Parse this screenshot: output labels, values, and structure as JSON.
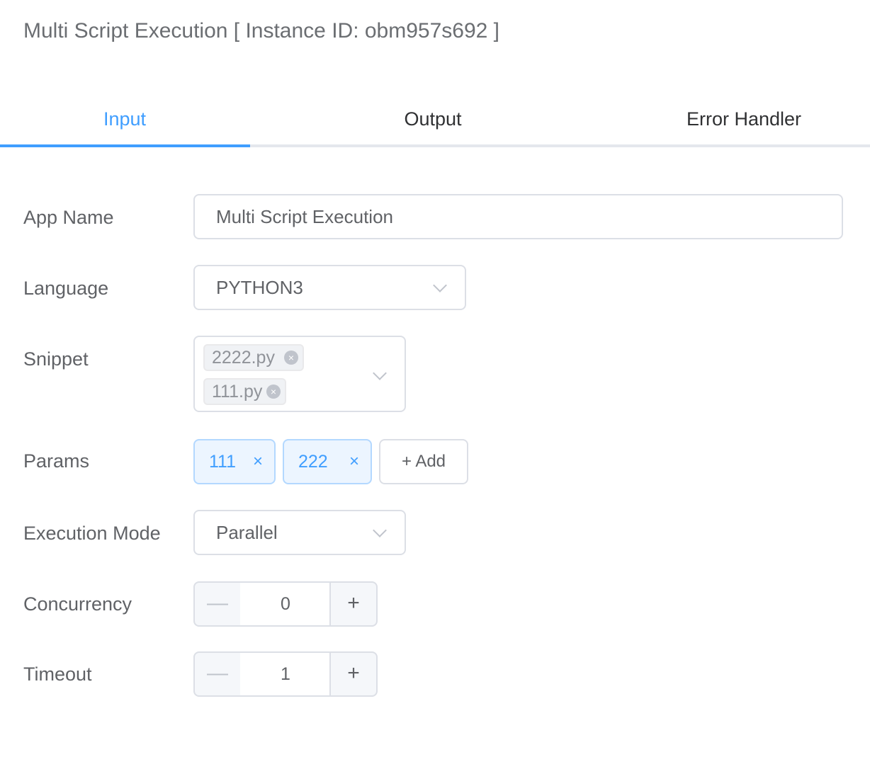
{
  "header": {
    "title": "Multi Script Execution [ Instance ID: obm957s692 ]"
  },
  "tabs": [
    {
      "label": "Input",
      "active": true
    },
    {
      "label": "Output",
      "active": false
    },
    {
      "label": "Error Handler",
      "active": false
    }
  ],
  "form": {
    "app_name": {
      "label": "App Name",
      "value": "Multi Script Execution"
    },
    "language": {
      "label": "Language",
      "value": "PYTHON3"
    },
    "snippet": {
      "label": "Snippet",
      "tags": [
        "2222.py",
        "111.py"
      ]
    },
    "params": {
      "label": "Params",
      "tags": [
        "111",
        "222"
      ],
      "add_label": "+ Add"
    },
    "execution_mode": {
      "label": "Execution Mode",
      "value": "Parallel"
    },
    "concurrency": {
      "label": "Concurrency",
      "value": "0"
    },
    "timeout": {
      "label": "Timeout",
      "value": "1"
    }
  },
  "glyphs": {
    "minus": "—",
    "plus": "+",
    "close": "×"
  },
  "colors": {
    "accent": "#409eff",
    "border": "#dcdfe6",
    "text": "#606266"
  }
}
